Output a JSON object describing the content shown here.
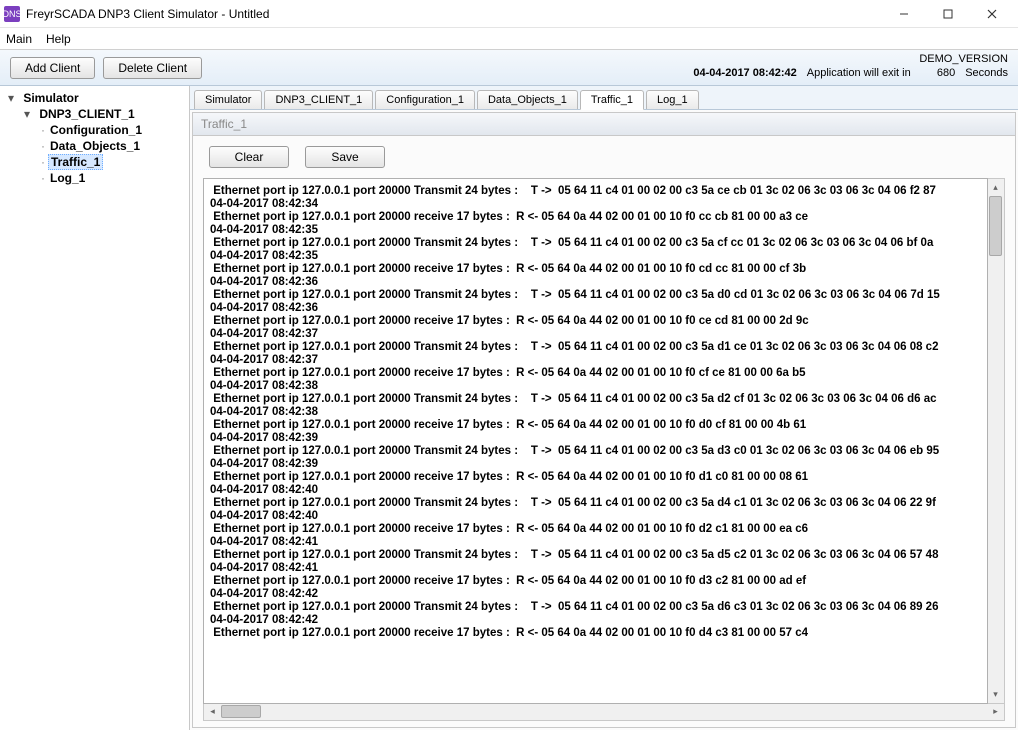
{
  "window": {
    "title": "FreyrSCADA DNP3 Client Simulator - Untitled",
    "app_abbrev": "DNS"
  },
  "menu": {
    "main": "Main",
    "help": "Help"
  },
  "toolbar": {
    "add_client": "Add Client",
    "delete_client": "Delete Client"
  },
  "status": {
    "demo": "DEMO_VERSION",
    "datetime": "04-04-2017 08:42:42",
    "exit_label": "Application will exit in",
    "exit_seconds": "680",
    "seconds_word": "Seconds"
  },
  "tree": {
    "root": "Simulator",
    "client": "DNP3_CLIENT_1",
    "children": [
      "Configuration_1",
      "Data_Objects_1",
      "Traffic_1",
      "Log_1"
    ],
    "selected_index": 2
  },
  "tabs": [
    "Simulator",
    "DNP3_CLIENT_1",
    "Configuration_1",
    "Data_Objects_1",
    "Traffic_1",
    "Log_1"
  ],
  "active_tab_index": 4,
  "panel": {
    "title": "Traffic_1",
    "clear": "Clear",
    "save": "Save"
  },
  "log_entries": [
    {
      "line": " Ethernet port ip 127.0.0.1 port 20000 Transmit 24 bytes :    T ->  05 64 11 c4 01 00 02 00 c3 5a ce cb 01 3c 02 06 3c 03 06 3c 04 06 f2 87",
      "ts": "04-04-2017 08:42:34"
    },
    {
      "line": " Ethernet port ip 127.0.0.1 port 20000 receive 17 bytes :  R <- 05 64 0a 44 02 00 01 00 10 f0 cc cb 81 00 00 a3 ce",
      "ts": "04-04-2017 08:42:35"
    },
    {
      "line": " Ethernet port ip 127.0.0.1 port 20000 Transmit 24 bytes :    T ->  05 64 11 c4 01 00 02 00 c3 5a cf cc 01 3c 02 06 3c 03 06 3c 04 06 bf 0a",
      "ts": "04-04-2017 08:42:35"
    },
    {
      "line": " Ethernet port ip 127.0.0.1 port 20000 receive 17 bytes :  R <- 05 64 0a 44 02 00 01 00 10 f0 cd cc 81 00 00 cf 3b",
      "ts": "04-04-2017 08:42:36"
    },
    {
      "line": " Ethernet port ip 127.0.0.1 port 20000 Transmit 24 bytes :    T ->  05 64 11 c4 01 00 02 00 c3 5a d0 cd 01 3c 02 06 3c 03 06 3c 04 06 7d 15",
      "ts": "04-04-2017 08:42:36"
    },
    {
      "line": " Ethernet port ip 127.0.0.1 port 20000 receive 17 bytes :  R <- 05 64 0a 44 02 00 01 00 10 f0 ce cd 81 00 00 2d 9c",
      "ts": "04-04-2017 08:42:37"
    },
    {
      "line": " Ethernet port ip 127.0.0.1 port 20000 Transmit 24 bytes :    T ->  05 64 11 c4 01 00 02 00 c3 5a d1 ce 01 3c 02 06 3c 03 06 3c 04 06 08 c2",
      "ts": "04-04-2017 08:42:37"
    },
    {
      "line": " Ethernet port ip 127.0.0.1 port 20000 receive 17 bytes :  R <- 05 64 0a 44 02 00 01 00 10 f0 cf ce 81 00 00 6a b5",
      "ts": "04-04-2017 08:42:38"
    },
    {
      "line": " Ethernet port ip 127.0.0.1 port 20000 Transmit 24 bytes :    T ->  05 64 11 c4 01 00 02 00 c3 5a d2 cf 01 3c 02 06 3c 03 06 3c 04 06 d6 ac",
      "ts": "04-04-2017 08:42:38"
    },
    {
      "line": " Ethernet port ip 127.0.0.1 port 20000 receive 17 bytes :  R <- 05 64 0a 44 02 00 01 00 10 f0 d0 cf 81 00 00 4b 61",
      "ts": "04-04-2017 08:42:39"
    },
    {
      "line": " Ethernet port ip 127.0.0.1 port 20000 Transmit 24 bytes :    T ->  05 64 11 c4 01 00 02 00 c3 5a d3 c0 01 3c 02 06 3c 03 06 3c 04 06 eb 95",
      "ts": "04-04-2017 08:42:39"
    },
    {
      "line": " Ethernet port ip 127.0.0.1 port 20000 receive 17 bytes :  R <- 05 64 0a 44 02 00 01 00 10 f0 d1 c0 81 00 00 08 61",
      "ts": "04-04-2017 08:42:40"
    },
    {
      "line": " Ethernet port ip 127.0.0.1 port 20000 Transmit 24 bytes :    T ->  05 64 11 c4 01 00 02 00 c3 5a d4 c1 01 3c 02 06 3c 03 06 3c 04 06 22 9f",
      "ts": "04-04-2017 08:42:40"
    },
    {
      "line": " Ethernet port ip 127.0.0.1 port 20000 receive 17 bytes :  R <- 05 64 0a 44 02 00 01 00 10 f0 d2 c1 81 00 00 ea c6",
      "ts": "04-04-2017 08:42:41"
    },
    {
      "line": " Ethernet port ip 127.0.0.1 port 20000 Transmit 24 bytes :    T ->  05 64 11 c4 01 00 02 00 c3 5a d5 c2 01 3c 02 06 3c 03 06 3c 04 06 57 48",
      "ts": "04-04-2017 08:42:41"
    },
    {
      "line": " Ethernet port ip 127.0.0.1 port 20000 receive 17 bytes :  R <- 05 64 0a 44 02 00 01 00 10 f0 d3 c2 81 00 00 ad ef",
      "ts": "04-04-2017 08:42:42"
    },
    {
      "line": " Ethernet port ip 127.0.0.1 port 20000 Transmit 24 bytes :    T ->  05 64 11 c4 01 00 02 00 c3 5a d6 c3 01 3c 02 06 3c 03 06 3c 04 06 89 26",
      "ts": "04-04-2017 08:42:42"
    },
    {
      "line": " Ethernet port ip 127.0.0.1 port 20000 receive 17 bytes :  R <- 05 64 0a 44 02 00 01 00 10 f0 d4 c3 81 00 00 57 c4",
      "ts": ""
    }
  ]
}
